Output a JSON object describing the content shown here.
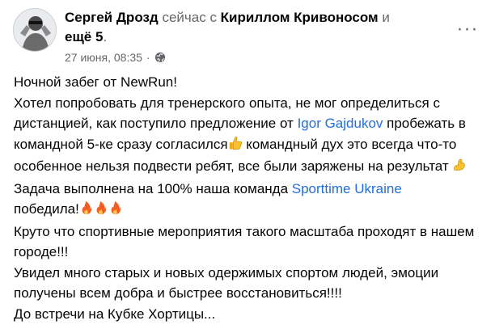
{
  "header": {
    "author": "Сергей Дрозд",
    "activity_mid": " сейчас с ",
    "with_name": "Кириллом Кривоносом",
    "and_text": " и",
    "others": "ещё 5",
    "others_suffix": ".",
    "timestamp": "27 июня, 08:35",
    "separator": "·",
    "privacy_icon": "globe-icon",
    "more_icon": "more-options-icon",
    "more_label": "···"
  },
  "post": {
    "line1": "Ночной забег от NewRun!",
    "line2": "Хотел попробовать для тренерского опыта, не мог определиться с дистанцией, как поступило предложение от ",
    "mention1": "Igor Gajdukov",
    "line3": " пробежать в командной 5-ке сразу согласился",
    "emoji_thumb": "thumbs-up-emoji",
    "line4": " командный дух это всегда что-то особенное нельзя подвести ребят, все были заряжены на результат ",
    "emoji_muscle": "flexed-biceps-emoji",
    "line5": "Задача выполнена на 100% наша команда ",
    "mention2": "Sporttime Ukraine",
    "line6": " победила!",
    "emoji_fire": "fire-emoji",
    "line7": "Круто что спортивные мероприятия такого масштаба проходят в нашем городе!!!",
    "line8": "Увидел много старых и новых одержимых спортом людей, эмоции получены всем добра и быстрее восстановиться!!!!",
    "line9": "До встречи на Кубке Хортицы..."
  },
  "colors": {
    "link": "#216fdb",
    "secondary_text": "#65676b",
    "primary_text": "#050505"
  }
}
